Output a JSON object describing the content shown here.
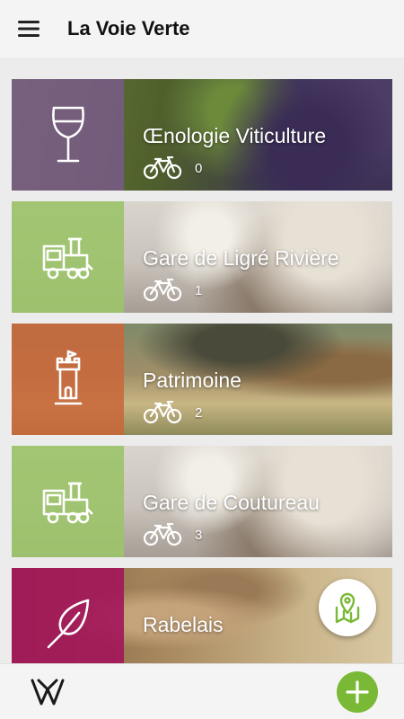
{
  "app": {
    "title": "La Voie Verte"
  },
  "icons": {
    "menu": "hamburger-menu-icon",
    "map": "map-pin-icon",
    "logo": "voie-verte-logo",
    "add": "plus-icon"
  },
  "colors": {
    "accent": "#7ab935",
    "card_purple": "#7a5a8c",
    "card_green": "#9cc36a",
    "card_orange": "#c8683a",
    "card_magenta": "#a3175a"
  },
  "cards": [
    {
      "title": "Œnologie Viticulture",
      "count": "0",
      "icon": "wine-glass-icon"
    },
    {
      "title": "Gare de Ligré Rivière",
      "count": "1",
      "icon": "train-icon"
    },
    {
      "title": "Patrimoine",
      "count": "2",
      "icon": "castle-tower-icon"
    },
    {
      "title": "Gare de Coutureau",
      "count": "3",
      "icon": "train-icon"
    },
    {
      "title": "Rabelais",
      "count": "",
      "icon": "feather-quill-icon"
    }
  ]
}
